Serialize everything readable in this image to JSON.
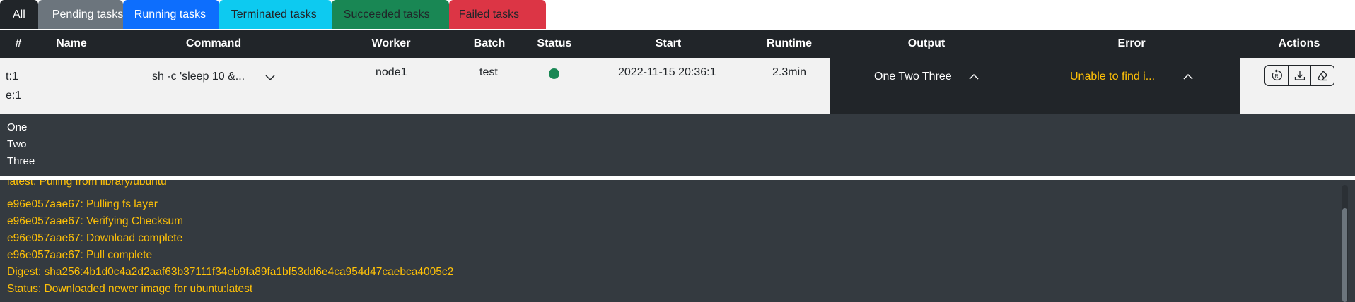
{
  "tabs": [
    {
      "label": "All"
    },
    {
      "label": "Pending tasks"
    },
    {
      "label": "Running tasks"
    },
    {
      "label": "Terminated tasks"
    },
    {
      "label": "Succeeded tasks"
    },
    {
      "label": "Failed tasks"
    }
  ],
  "table": {
    "headers": [
      "#",
      "Name",
      "Command",
      "Worker",
      "Batch",
      "Status",
      "Start",
      "Runtime",
      "Output",
      "Error",
      "Actions"
    ]
  },
  "row": {
    "task_id": "t:1",
    "exec_id": "e:1",
    "name": "",
    "command": "sh -c 'sleep 10 &...",
    "worker": "node1",
    "batch": "test",
    "status_icon": "status-dot",
    "status_color": "#198754",
    "start": "2022-11-15 20:36:1",
    "runtime": "2.3min",
    "output_preview": "One Two Three",
    "error_preview": "Unable to find i...",
    "actions": [
      {
        "icon": "restart-icon"
      },
      {
        "icon": "download-icon"
      },
      {
        "icon": "eraser-icon"
      }
    ]
  },
  "output_lines": [
    "One",
    "Two",
    "Three"
  ],
  "error_lines": [
    "latest: Pulling from library/ubuntu",
    "e96e057aae67: Pulling fs layer",
    "e96e057aae67: Verifying Checksum",
    "e96e057aae67: Download complete",
    "e96e057aae67: Pull complete",
    "Digest: sha256:4b1d0c4a2d2aaf63b37111f34eb9fa89fa1bf53dd6e4ca954d47caebca4005c2",
    "Status: Downloaded newer image for ubuntu:latest"
  ],
  "colors": {
    "dark": "#212529",
    "panel": "#343a40",
    "error_text": "#ffc107",
    "success": "#198754"
  }
}
